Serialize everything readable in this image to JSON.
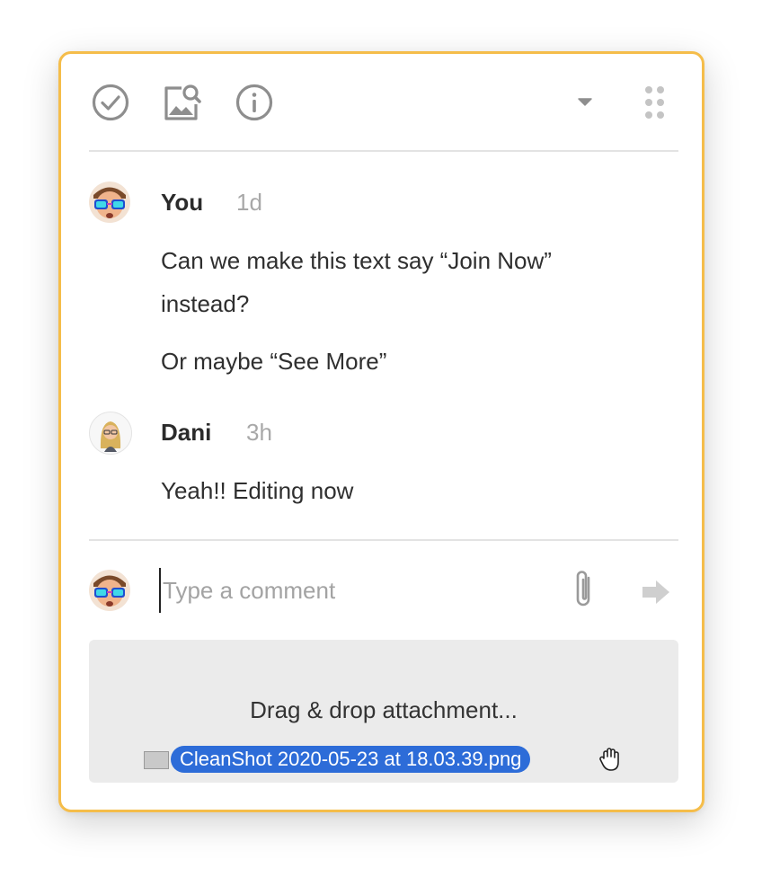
{
  "toolbar": {
    "icons": [
      "resolve-check-icon",
      "image-search-icon",
      "info-icon",
      "dropdown-caret-icon",
      "drag-handle-icon"
    ]
  },
  "comments": [
    {
      "author": "You",
      "time": "1d",
      "lines": [
        "Can we make this text say “Join Now”",
        "instead?",
        "Or maybe “See More”"
      ]
    },
    {
      "author": "Dani",
      "time": "3h",
      "lines": [
        "Yeah!! Editing now"
      ]
    }
  ],
  "composer": {
    "placeholder": "Type a comment"
  },
  "dropzone": {
    "label": "Drag & drop attachment...",
    "file_name": "CleanShot 2020-05-23 at 18.03.39.png"
  },
  "colors": {
    "border_accent": "#f5bd4a",
    "file_pill": "#2d6cd8",
    "icon_gray": "#8e8e8e"
  }
}
